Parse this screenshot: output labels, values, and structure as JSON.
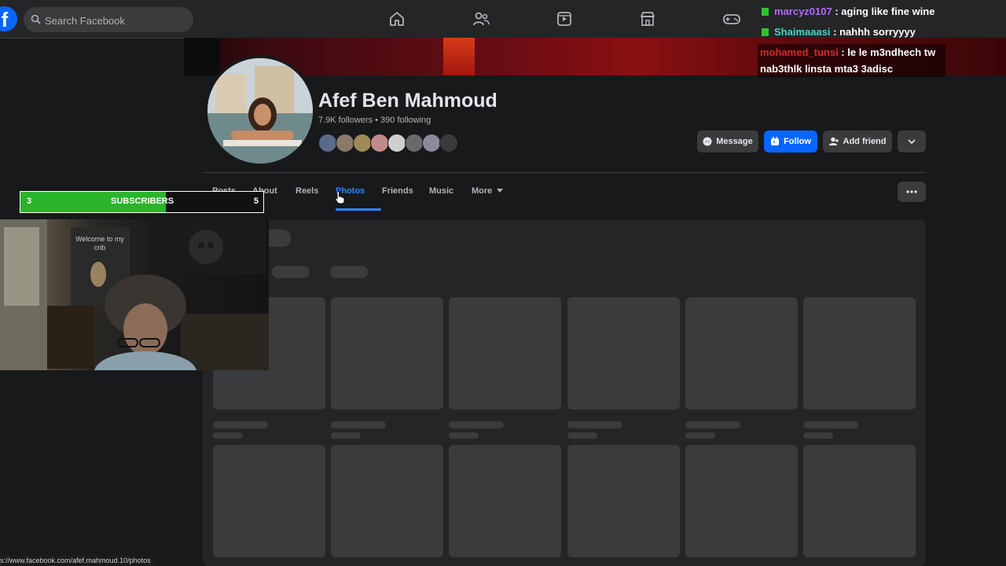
{
  "topbar": {
    "logo_letter": "f",
    "search_placeholder": "Search Facebook",
    "nav_icons": [
      "home-icon",
      "friends-icon",
      "video-icon",
      "marketplace-icon",
      "gaming-icon"
    ]
  },
  "profile": {
    "name": "Afef Ben Mahmoud",
    "stats": "7.9K followers • 390 following",
    "buttons": {
      "message": "Message",
      "follow": "Follow",
      "add_friend": "Add friend"
    }
  },
  "tabs": [
    "Posts",
    "About",
    "Reels",
    "Photos",
    "Friends",
    "Music",
    "More"
  ],
  "active_tab": "Photos",
  "subscriber_bar": {
    "current": "3",
    "label": "SUBSCRIBERS",
    "goal": "5",
    "progress_fraction": 0.6
  },
  "webcam": {
    "poster_text": "Welcome to  my crib"
  },
  "chat": [
    {
      "user": "marcyz0107",
      "user_color": "#b36bff",
      "message": " : aging like fine wine"
    },
    {
      "user": "Shaimaaasi",
      "user_color": "#4fd1c5",
      "message": " : nahhh sorryyyy"
    },
    {
      "user": "mohamed_tunsi",
      "user_color": "#d12b2b",
      "message": " : le le m3ndhech tw nab3thlk linsta mta3 3adisc"
    }
  ],
  "status_url": "s://www.facebook.com/afef.mahmoud.10/photos",
  "colors": {
    "accent": "#0866ff",
    "active_tab": "#2d88ff",
    "background": "#18191a",
    "subscriber_fill": "#2bb32b"
  }
}
